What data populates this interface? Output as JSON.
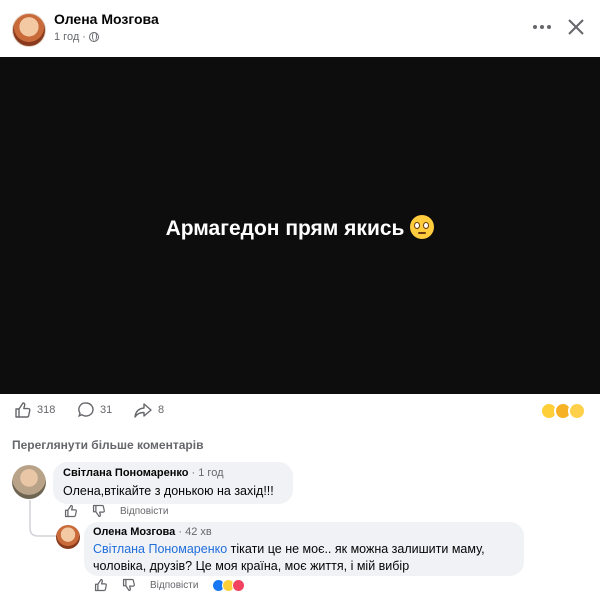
{
  "post": {
    "author": "Олена Мозгова",
    "time": "1 год",
    "text": "Армагедон прям якись",
    "emoji": "face-with-rolling-eyes"
  },
  "stats": {
    "likes": "318",
    "comments": "31",
    "shares": "8"
  },
  "colors": {
    "mention": "#216fdb",
    "meta_text": "#65676b",
    "bubble": "#f0f2f5",
    "media_bg": "#0d0d0d"
  },
  "view_more_comments": "Переглянути більше коментарів",
  "comments": [
    {
      "author": "Світлана Пономаренко",
      "time": "1 год",
      "text": "Олена,втікайте з донькою на захід!!!",
      "reply_label": "Відповісти"
    },
    {
      "author": "Олена Мозгова",
      "time": "42 хв",
      "mention": "Світлана Пономаренко",
      "text": " тікати це не моє.. як можна залишити маму, чоловіка, друзів? Це моя країна, моє життя, і мій вибір",
      "reply_label": "Відповісти"
    }
  ]
}
